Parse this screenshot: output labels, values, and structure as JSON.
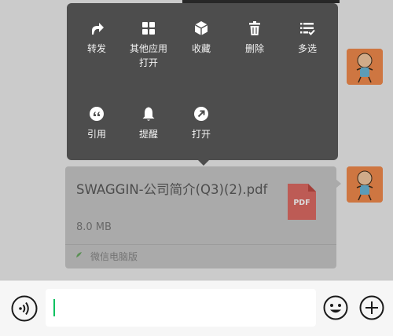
{
  "context_menu": {
    "items": [
      {
        "id": "forward",
        "label": "转发",
        "icon": "forward-icon"
      },
      {
        "id": "open-other",
        "label": "其他应用\n打开",
        "icon": "apps-grid-icon"
      },
      {
        "id": "favorite",
        "label": "收藏",
        "icon": "cube-icon"
      },
      {
        "id": "delete",
        "label": "删除",
        "icon": "trash-icon"
      },
      {
        "id": "multi-select",
        "label": "多选",
        "icon": "checklist-icon"
      },
      {
        "id": "quote",
        "label": "引用",
        "icon": "quote-icon"
      },
      {
        "id": "remind",
        "label": "提醒",
        "icon": "bell-icon"
      },
      {
        "id": "open",
        "label": "打开",
        "icon": "open-arrow-icon"
      }
    ]
  },
  "file_message": {
    "file_name": "SWAGGIN-公司简介(Q3)(2).pdf",
    "file_size": "8.0 MB",
    "file_type_label": "PDF",
    "source_label": "微信电脑版"
  },
  "input_bar": {
    "input_value": ""
  },
  "colors": {
    "menu_background": "#4d4d4d",
    "pdf_icon": "#e05a52",
    "avatar_background": "#f08a4c",
    "cursor": "#07c160"
  }
}
